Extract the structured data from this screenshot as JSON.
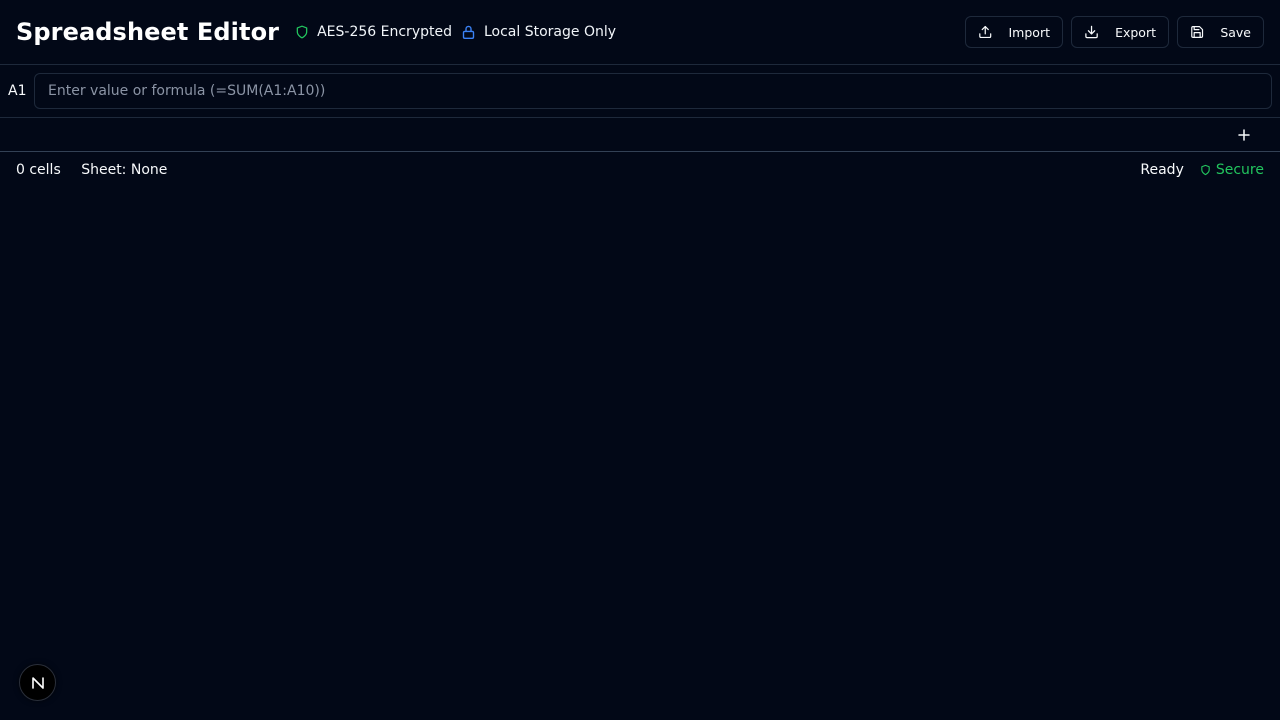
{
  "header": {
    "title": "Spreadsheet Editor",
    "encryption_badge": "AES-256 Encrypted",
    "storage_badge": "Local Storage Only",
    "actions": {
      "import_label": "Import",
      "export_label": "Export",
      "save_label": "Save"
    }
  },
  "formula_bar": {
    "cell_ref": "A1",
    "value": "",
    "placeholder": "Enter value or formula (=SUM(A1:A10))"
  },
  "sheet_tabs": {
    "add_label": "+"
  },
  "status_bar": {
    "cell_count": "0 cells",
    "sheet": "Sheet: None",
    "state": "Ready",
    "security": "Secure"
  },
  "dev_badge": {
    "letter": "N"
  },
  "colors": {
    "background": "#020817",
    "border": "#1e293b",
    "accent_green": "#22c55e",
    "accent_blue": "#3b82f6"
  },
  "icons": {
    "encryption": "shield-icon",
    "storage": "lock-icon",
    "import": "upload-icon",
    "export": "download-icon",
    "save": "save-icon",
    "secure": "shield-icon"
  }
}
